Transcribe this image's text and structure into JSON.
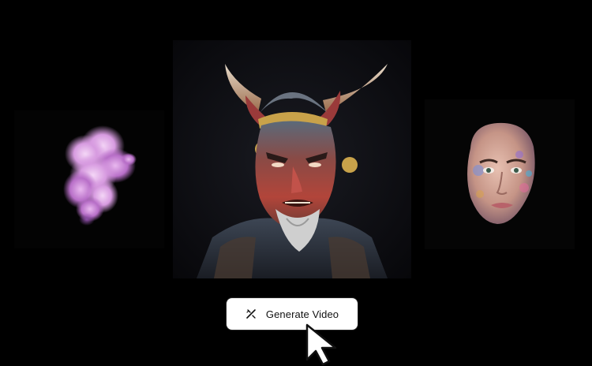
{
  "app": {
    "background_color": "#000000"
  },
  "gallery": {
    "left_card": {
      "icon": "smoke-icon",
      "color": "#d9a6e0"
    },
    "center_card": {
      "icon": "demon-portrait-icon",
      "color": "#c0392b"
    },
    "right_card": {
      "icon": "face-portrait-icon",
      "color": "#d8a79a"
    }
  },
  "action": {
    "generate_button_label": "Generate Video",
    "generate_button_icon": "magic-wand-icon",
    "button_bg": "#ffffff",
    "button_text_color": "#111111"
  },
  "pointer": {
    "icon": "mouse-cursor-icon"
  }
}
